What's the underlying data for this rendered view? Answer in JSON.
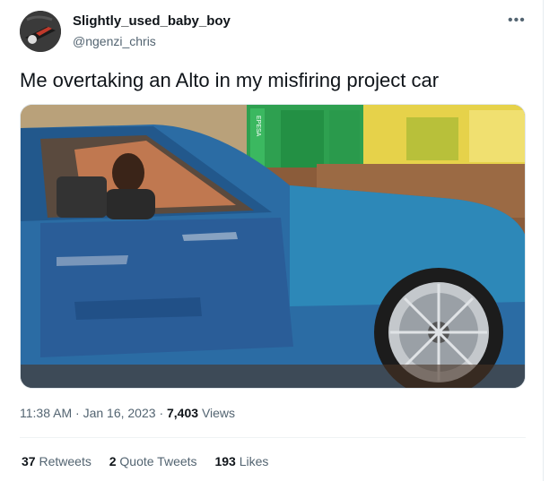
{
  "author": {
    "display_name": "Slightly_used_baby_boy",
    "handle": "@ngenzi_chris"
  },
  "more_icon": "more-options-icon",
  "tweet": {
    "text": "Me overtaking an Alto in my misfiring project car"
  },
  "media": {
    "shop_sign": "EPESA",
    "image_icon": "video-frame"
  },
  "meta": {
    "time": "11:38 AM",
    "sep1": "·",
    "date": "Jan 16, 2023",
    "sep2": "·",
    "views_count": "7,403",
    "views_label": "Views"
  },
  "stats": {
    "retweets_count": "37",
    "retweets_label": "Retweets",
    "quotes_count": "2",
    "quotes_label": "Quote Tweets",
    "likes_count": "193",
    "likes_label": "Likes"
  },
  "colors": {
    "car_blue": "#2a6ea8",
    "shop_green": "#2ea050",
    "wall_yellow": "#e6d24a"
  }
}
